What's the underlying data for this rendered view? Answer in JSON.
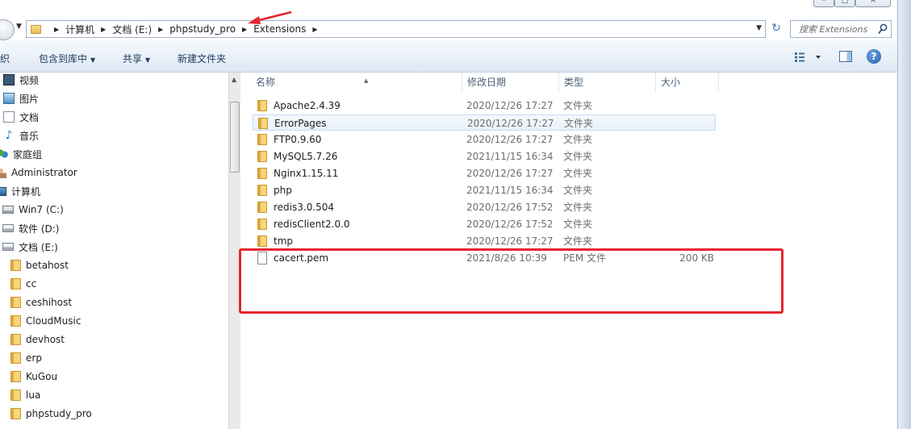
{
  "window": {
    "min_glyph": "─",
    "max_glyph": "□",
    "close_glyph": "✕"
  },
  "address": {
    "crumbs": [
      "计算机",
      "文档 (E:)",
      "phpstudy_pro",
      "Extensions"
    ]
  },
  "search": {
    "placeholder": "搜索 Extensions"
  },
  "toolbar": {
    "organize_label": "织",
    "include_label": "包含到库中",
    "share_label": "共享",
    "new_folder_label": "新建文件夹"
  },
  "icons": {
    "refresh": "↻",
    "help": "?",
    "music": "♪"
  },
  "navpane": {
    "items": [
      {
        "label": "视频",
        "icon": "video-icon"
      },
      {
        "label": "图片",
        "icon": "pictures-icon"
      },
      {
        "label": "文档",
        "icon": "documents-icon"
      },
      {
        "label": "音乐",
        "icon": "music-icon"
      },
      {
        "label": "家庭组",
        "icon": "homegroup-icon"
      },
      {
        "label": "Administrator",
        "icon": "user-icon"
      },
      {
        "label": "计算机",
        "icon": "computer-icon"
      },
      {
        "label": "Win7 (C:)",
        "icon": "system-drive-icon"
      },
      {
        "label": "软件 (D:)",
        "icon": "drive-icon"
      },
      {
        "label": "文档 (E:)",
        "icon": "drive-icon"
      },
      {
        "label": "betahost",
        "icon": "folder-icon"
      },
      {
        "label": "cc",
        "icon": "folder-icon"
      },
      {
        "label": "ceshihost",
        "icon": "folder-icon"
      },
      {
        "label": "CloudMusic",
        "icon": "folder-icon"
      },
      {
        "label": "devhost",
        "icon": "folder-icon"
      },
      {
        "label": "erp",
        "icon": "folder-icon"
      },
      {
        "label": "KuGou",
        "icon": "folder-icon"
      },
      {
        "label": "lua",
        "icon": "folder-icon"
      },
      {
        "label": "phpstudy_pro",
        "icon": "folder-icon"
      }
    ]
  },
  "filelist": {
    "columns": {
      "name": "名称",
      "modified": "修改日期",
      "type": "类型",
      "size": "大小"
    },
    "rows": [
      {
        "name": "Apache2.4.39",
        "modified": "2020/12/26 17:27",
        "type": "文件夹",
        "size": "",
        "kind": "folder"
      },
      {
        "name": "ErrorPages",
        "modified": "2020/12/26 17:27",
        "type": "文件夹",
        "size": "",
        "kind": "folder",
        "selected": true
      },
      {
        "name": "FTP0.9.60",
        "modified": "2020/12/26 17:27",
        "type": "文件夹",
        "size": "",
        "kind": "folder"
      },
      {
        "name": "MySQL5.7.26",
        "modified": "2021/11/15 16:34",
        "type": "文件夹",
        "size": "",
        "kind": "folder"
      },
      {
        "name": "Nginx1.15.11",
        "modified": "2020/12/26 17:27",
        "type": "文件夹",
        "size": "",
        "kind": "folder"
      },
      {
        "name": "php",
        "modified": "2021/11/15 16:34",
        "type": "文件夹",
        "size": "",
        "kind": "folder"
      },
      {
        "name": "redis3.0.504",
        "modified": "2020/12/26 17:52",
        "type": "文件夹",
        "size": "",
        "kind": "folder"
      },
      {
        "name": "redisClient2.0.0",
        "modified": "2020/12/26 17:52",
        "type": "文件夹",
        "size": "",
        "kind": "folder"
      },
      {
        "name": "tmp",
        "modified": "2020/12/26 17:27",
        "type": "文件夹",
        "size": "",
        "kind": "folder"
      },
      {
        "name": "cacert.pem",
        "modified": "2021/8/26 10:39",
        "type": "PEM 文件",
        "size": "200 KB",
        "kind": "file"
      }
    ]
  },
  "annotation": {
    "color": "#e5252f"
  }
}
